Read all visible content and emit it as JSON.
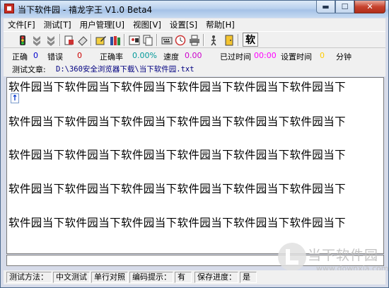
{
  "window": {
    "title": "当下软件园 - 禧龙字王 V1.0 Beta4",
    "min_label": "▬",
    "max_label": "☐",
    "close_label": "✕"
  },
  "menu": {
    "items": [
      {
        "label": "文件[F]"
      },
      {
        "label": "测试[T]"
      },
      {
        "label": "用户管理[U]"
      },
      {
        "label": "视图[V]"
      },
      {
        "label": "设置[S]"
      },
      {
        "label": "帮助[H]"
      }
    ]
  },
  "toolbar": {
    "big_button_label": "软"
  },
  "stats": {
    "correct_label": "正确",
    "correct_value": "0",
    "error_label": "错误",
    "error_value": "0",
    "rate_label": "正确率",
    "rate_value": "0.00%",
    "speed_label": "速度",
    "speed_value": "0.00",
    "elapsed_label": "已过时间",
    "elapsed_value": "00:00",
    "set_time_label": "设置时间",
    "set_time_value": "0",
    "minute_label": "分钟",
    "article_label": "测试文章:",
    "article_path": "D:\\360安全浏览器下载\\当下软件园.txt"
  },
  "typing": {
    "lines": [
      "软件园当下软件园当下软件园当下软件园当下软件园当下软件园当下",
      "软件园当下软件园当下软件园当下软件园当下软件园当下软件园当下",
      "软件园当下软件园当下软件园当下软件园当下软件园当下软件园当下",
      "软件园当下软件园当下软件园当下软件园当下软件园当下软件园当下",
      "软件园当下软件园当下软件园当下软件园当下软件园当下软件园当下"
    ],
    "cursor_glyph": "↑"
  },
  "statusbar": {
    "method_label": "测试方法：",
    "method_value": "中文测试",
    "mode_value": "单行对照",
    "hint_label": "编码提示：",
    "hint_value": "有",
    "save_label": "保存进度：",
    "save_value": "是"
  },
  "watermark": {
    "brand": "当下软件园",
    "url": "www.downxia.com"
  },
  "colors": {
    "correct": "#0000cc",
    "error": "#cc0000",
    "rate": "#009999",
    "speed": "#cc00cc",
    "elapsed": "#ff00ff",
    "set_time": "#ffcc00",
    "path": "#000080"
  }
}
